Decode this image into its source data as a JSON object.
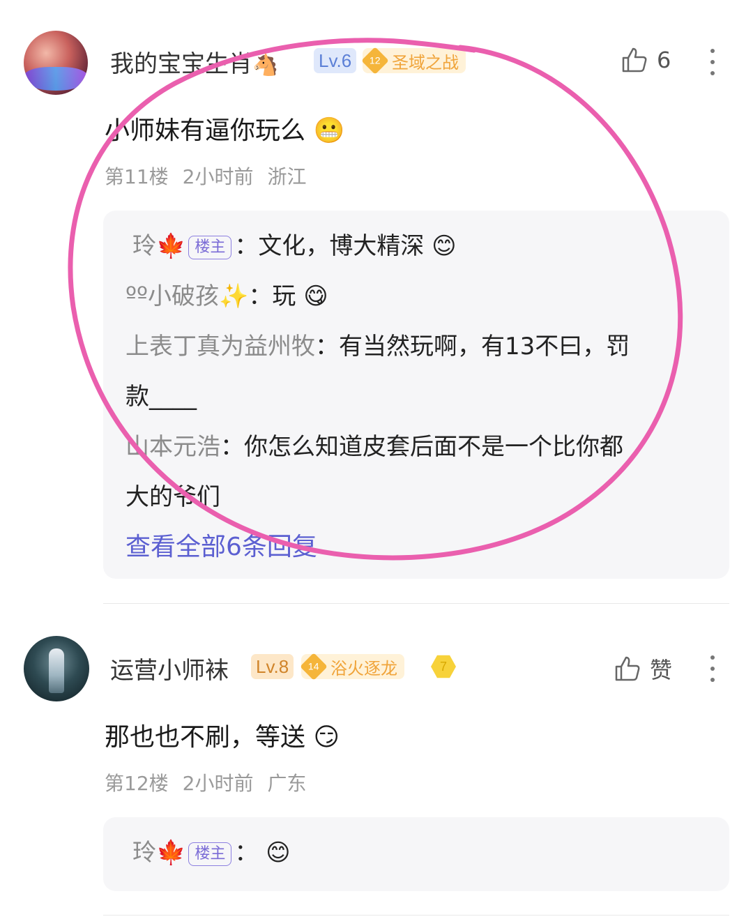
{
  "comment1": {
    "username": "我的宝宝生肖",
    "username_emoji": "🐴",
    "level": "Lv.6",
    "medal_level": "12",
    "medal_name": "圣域之战",
    "like_count": "6",
    "text": "小师妹有逼你玩么",
    "text_emoji": "😬",
    "floor": "第11楼",
    "time": "2小时前",
    "location": "浙江",
    "replies": [
      {
        "name": "玲🍁",
        "host_tag": "楼主",
        "sep": "：",
        "text": "文化，博大精深",
        "emoji": "😊"
      },
      {
        "name": "ºº小破孩✨",
        "sep": "：",
        "text": "玩",
        "emoji": "😋"
      },
      {
        "name": "上表丁真为益州牧",
        "sep": "：",
        "text": "有当然玩啊，有13不曰，罚",
        "text2": "款____"
      },
      {
        "name": "山本元浩",
        "sep": "：",
        "text": "你怎么知道皮套后面不是一个比你都",
        "text2": "大的爷们"
      }
    ],
    "view_all": "查看全部6条回复"
  },
  "comment2": {
    "username": "运营小师袜",
    "level": "Lv.8",
    "medal_level": "14",
    "medal_name": "浴火逐龙",
    "hex_badge": "7",
    "like_label": "赞",
    "text": "那也也不刷，等送",
    "text_emoji": "😏",
    "floor": "第12楼",
    "time": "2小时前",
    "location": "广东",
    "replies": [
      {
        "name": "玲🍁",
        "host_tag": "楼主",
        "sep": "：",
        "emoji": "😊"
      }
    ]
  },
  "colors": {
    "annotation_circle": "#ea5fae",
    "link": "#5b5fd1"
  }
}
